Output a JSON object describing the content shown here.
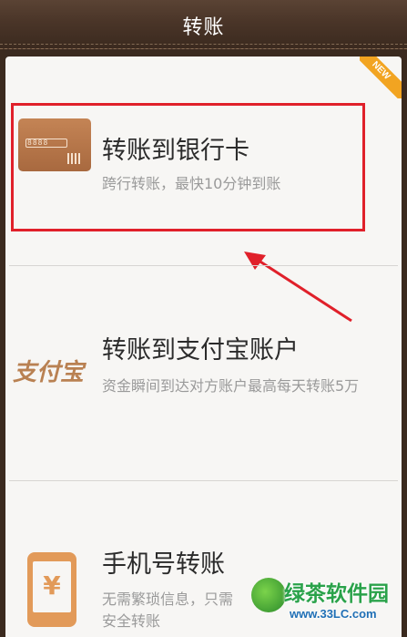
{
  "header": {
    "title": "转账"
  },
  "badge": {
    "new_label": "NEW"
  },
  "items": [
    {
      "title": "转账到银行卡",
      "desc": "跨行转账，最快10分钟到账",
      "icon": "bank-card-icon",
      "icon_digits": "8888"
    },
    {
      "title": "转账到支付宝账户",
      "desc": "资金瞬间到达对方账户最高每天转账5万",
      "icon": "alipay-logo",
      "logo_text": "支付宝"
    },
    {
      "title": "手机号转账",
      "desc_line1": "无需繁琐信息，只需",
      "desc_line2": "安全转账",
      "icon": "phone-yen-icon",
      "icon_symbol": "¥"
    }
  ],
  "watermark": {
    "main": "绿茶软件园",
    "sub": "www.33LC.com"
  },
  "colors": {
    "header": "#4a3528",
    "highlight": "#e0202a",
    "badge": "#f2a421",
    "title": "#2b2b2b",
    "desc": "#9a9a9a",
    "brand": "#b98152"
  }
}
